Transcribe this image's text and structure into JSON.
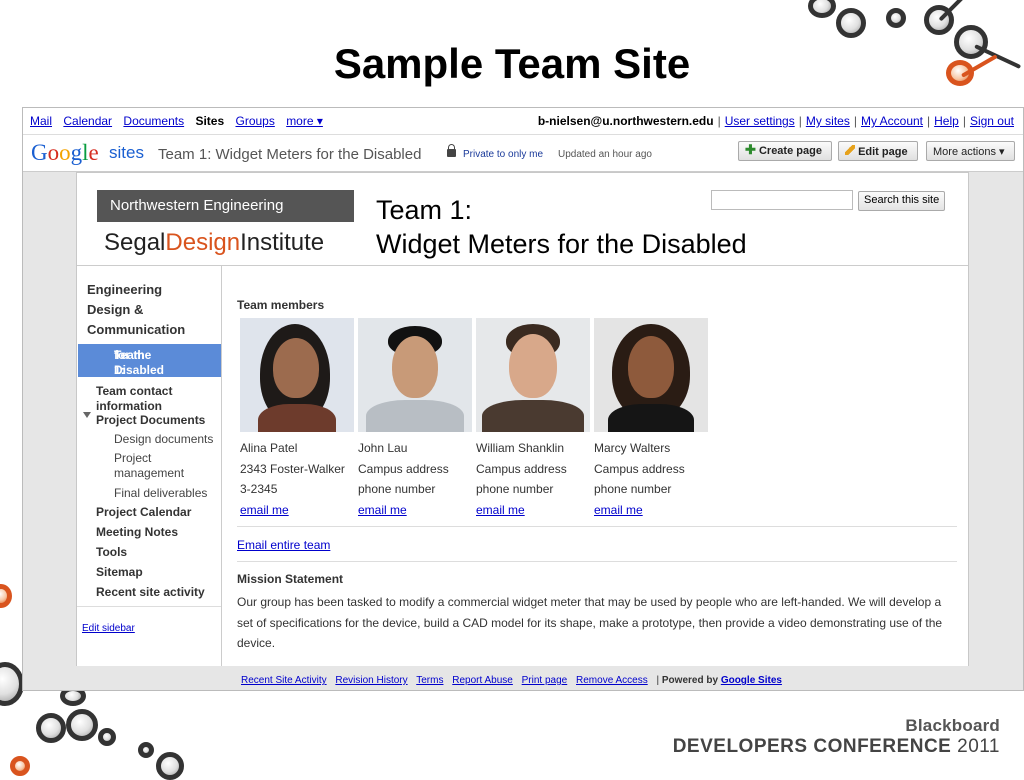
{
  "slide": {
    "title": "Sample Team Site",
    "footer_brand": "Blackboard",
    "footer_conference": "DEVELOPERS CONFERENCE",
    "footer_year": "2011"
  },
  "google_bar": {
    "links": [
      "Mail",
      "Calendar",
      "Documents",
      "Sites",
      "Groups",
      "more ▾"
    ],
    "current": "Sites",
    "email": "b-nielsen@u.northwestern.edu",
    "user_links": [
      "User settings",
      "My sites",
      "My Account",
      "Help",
      "Sign out"
    ]
  },
  "site_bar": {
    "logo_letters": [
      "G",
      "o",
      "o",
      "g",
      "l",
      "e"
    ],
    "product": "sites",
    "site_name": "Team 1: Widget Meters for the Disabled",
    "privacy": "Private to only me",
    "updated": "Updated an hour ago",
    "create_page": "Create page",
    "edit_page": "Edit page",
    "more_actions": "More actions ▾"
  },
  "header": {
    "org_box": "Northwestern Engineering",
    "institute_pre": "Segal",
    "institute_mid": "Design",
    "institute_post": "Institute",
    "title_line1": "Team 1:",
    "title_line2": "Widget Meters for the Disabled",
    "search_value": "",
    "search_button": "Search this site"
  },
  "sidebar": {
    "heading_lines": [
      "Engineering",
      "Design &",
      "Communication"
    ],
    "selected_lines": [
      "Team 1: Widget Meters",
      "for the Disabled"
    ],
    "items": {
      "team_contact": [
        "Team contact",
        "information"
      ],
      "project_documents": "Project Documents",
      "design_documents": "Design documents",
      "project_management": [
        "Project",
        "management"
      ],
      "final_deliverables": "Final deliverables",
      "project_calendar": "Project Calendar",
      "meeting_notes": "Meeting Notes",
      "tools": "Tools",
      "sitemap": "Sitemap",
      "recent_activity": "Recent site activity"
    },
    "edit_link": "Edit sidebar"
  },
  "content": {
    "members_heading": "Team members",
    "members": [
      {
        "name": "Alina Patel",
        "address": "2343 Foster-Walker",
        "phone": "3-2345",
        "email_label": "email me"
      },
      {
        "name": "John Lau",
        "address": "Campus address",
        "phone": "phone number",
        "email_label": "email me"
      },
      {
        "name": "William Shanklin",
        "address": "Campus address",
        "phone": "phone number",
        "email_label": "email me"
      },
      {
        "name": "Marcy Walters",
        "address": "Campus address",
        "phone": "phone number",
        "email_label": "email me"
      }
    ],
    "email_team": "Email entire team",
    "mission_heading": "Mission Statement",
    "mission_text": "Our group has been tasked to modify a commercial widget meter that may be used by people who are left-handed.  We will develop a set of specifications for the device, build a CAD model for its shape, make a prototype, then provide a video demonstrating use of the device."
  },
  "footer": {
    "links": [
      "Recent Site Activity",
      "Revision History",
      "Terms",
      "Report Abuse",
      "Print page",
      "Remove Access"
    ],
    "powered_prefix": "Powered by",
    "powered_link": "Google Sites"
  }
}
